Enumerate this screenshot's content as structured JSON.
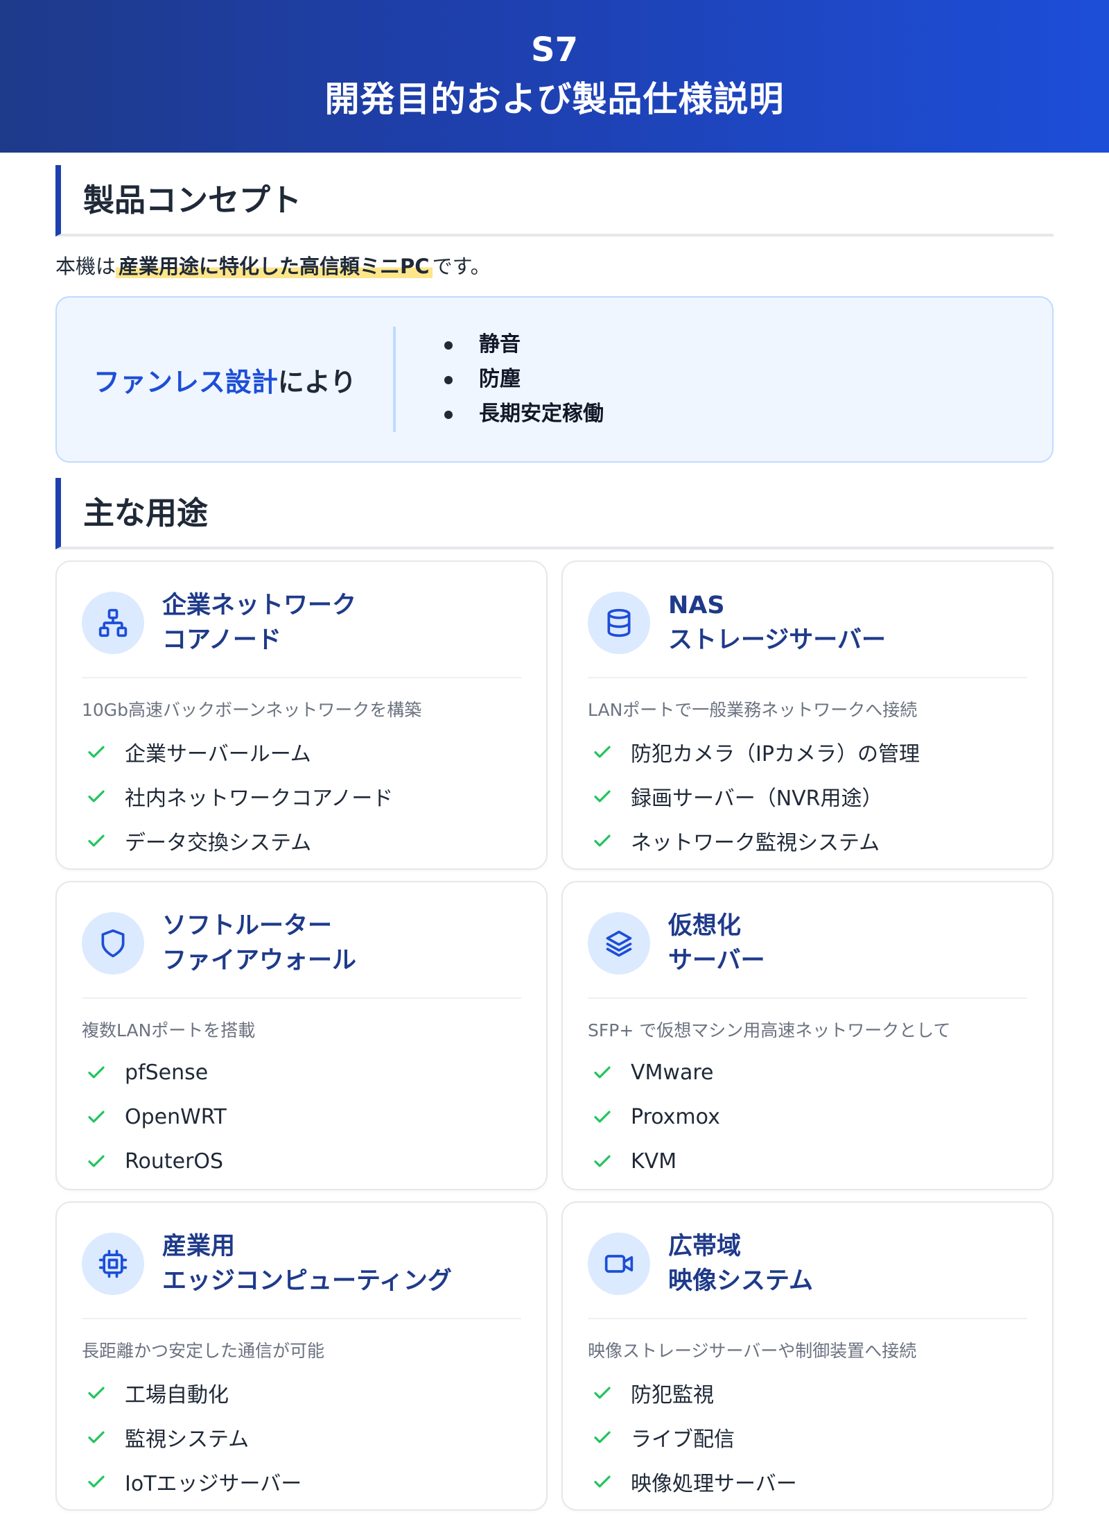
{
  "header": {
    "model": "S7",
    "title": "開発目的および製品仕様説明"
  },
  "concept": {
    "heading": "製品コンセプト",
    "intro_prefix": "本機は",
    "intro_highlight": "産業用途に特化した高信頼ミニPC",
    "intro_suffix": "です。",
    "box_accent": "ファンレス設計",
    "box_suffix": "により",
    "features": [
      "静音",
      "防塵",
      "長期安定稼働"
    ]
  },
  "uses": {
    "heading": "主な用途",
    "cards": [
      {
        "icon": "network-icon",
        "title_line1": "企業ネットワーク",
        "title_line2": "コアノード",
        "desc": "10Gb高速バックボーンネットワークを構築",
        "items": [
          "企業サーバールーム",
          "社内ネットワークコアノード",
          "データ交換システム"
        ]
      },
      {
        "icon": "database-icon",
        "title_line1": "NAS",
        "title_line2": "ストレージサーバー",
        "desc": "LANポートで一般業務ネットワークへ接続",
        "items": [
          "防犯カメラ（IPカメラ）の管理",
          "録画サーバー（NVR用途）",
          "ネットワーク監視システム"
        ]
      },
      {
        "icon": "shield-icon",
        "title_line1": "ソフトルーター",
        "title_line2": "ファイアウォール",
        "desc": "複数LANポートを搭載",
        "items": [
          "pfSense",
          "OpenWRT",
          "RouterOS"
        ]
      },
      {
        "icon": "layers-icon",
        "title_line1": "仮想化",
        "title_line2": "サーバー",
        "desc": "SFP+ で仮想マシン用高速ネットワークとして",
        "items": [
          "VMware",
          "Proxmox",
          "KVM"
        ]
      },
      {
        "icon": "cpu-icon",
        "title_line1": "産業用",
        "title_line2": "エッジコンピューティング",
        "desc": "長距離かつ安定した通信が可能",
        "items": [
          "工場自動化",
          "監視システム",
          "IoTエッジサーバー"
        ]
      },
      {
        "icon": "video-camera-icon",
        "title_line1": "広帯域",
        "title_line2": "映像システム",
        "desc": "映像ストレージサーバーや制御装置へ接続",
        "items": [
          "防犯監視",
          "ライブ配信",
          "映像処理サーバー"
        ]
      }
    ]
  },
  "colors": {
    "header": "#1e40af",
    "accent": "#1d4ed8",
    "check": "#22c55e",
    "highlight": "#fde68a"
  }
}
